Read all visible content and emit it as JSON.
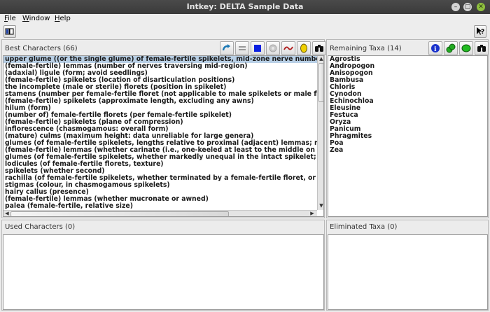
{
  "window": {
    "title": "Intkey: DELTA Sample Data",
    "controls": {
      "minimize": "–",
      "maximize": "▢",
      "close": "✕"
    }
  },
  "menubar": {
    "items": [
      {
        "label": "File",
        "mnemonic": "F",
        "rest": "ile"
      },
      {
        "label": "Window",
        "mnemonic": "W",
        "rest": "indow"
      },
      {
        "label": "Help",
        "mnemonic": "H",
        "rest": "elp"
      }
    ]
  },
  "toolbar": {
    "left_icon": "book-icon",
    "right_icon": "context-help-icon",
    "right_label": "?"
  },
  "best_characters": {
    "title": "Best Characters (66)",
    "buttons": [
      "restart-icon",
      "separate-icon",
      "diagnose-icon",
      "find-character-icon",
      "chart-icon",
      "info-icon",
      "binoculars-icon"
    ],
    "selected_index": 0,
    "items": [
      "upper glume ((or the single glume) of female-fertile spikelets, mid-zone nerve number)",
      "(female-fertile) lemmas (number of nerves traversing mid-region)",
      "(adaxial) ligule (form; avoid seedlings)",
      "(female-fertile) spikelets (location of disarticulation positions)",
      "the incomplete (male or sterile) florets (position in spikelet)",
      "stamens (number per female-fertile floret (not applicable to male spikelets or male florets))",
      "(female-fertile) spikelets (approximate length, excluding any awns)",
      "hilum (form)",
      "(number of) female-fertile florets (per female-fertile spikelet)",
      "(female-fertile) spikelets (plane of compression)",
      "inflorescence (chasmogamous: overall form)",
      "(mature) culms (maximum height: data unreliable for large genera)",
      "glumes (of female-fertile spikelets, lengths relative to proximal (adjacent) lemmas; refers to th",
      "(female-fertile) lemmas (whether carinate (i.e., one-keeled at least to the middle on the back)",
      "glumes (of female-fertile spikelets, whether markedly unequal in the intact spikelet; regardles",
      "lodicules (of female-fertile florets, texture)",
      "spikelets (whether second)",
      "rachilla (of female-fertile spikelets, whether terminated by a female-fertile floret, or ‘prolonge",
      "stigmas (colour, in chasmogamous spikelets)",
      "hairy callus (presence)",
      "(female-fertile) lemmas (whether mucronate or awned)",
      "palea (female-fertile, relative size)"
    ]
  },
  "remaining_taxa": {
    "title": "Remaining Taxa (14)",
    "buttons": [
      "info-icon",
      "differences-icon",
      "taxa-icon",
      "binoculars-icon"
    ],
    "items": [
      "Agrostis",
      "Andropogon",
      "Anisopogon",
      "Bambusa",
      "Chloris",
      "Cynodon",
      "Echinochloa",
      "Eleusine",
      "Festuca",
      "Oryza",
      "Panicum",
      "Phragmites",
      "Poa",
      "Zea"
    ]
  },
  "used_characters": {
    "title": "Used Characters (0)"
  },
  "eliminated_taxa": {
    "title": "Eliminated Taxa (0)"
  },
  "colors": {
    "selection": "#b8cfe5",
    "titlebar": "#3f3f3f",
    "close": "#8fc13e"
  }
}
